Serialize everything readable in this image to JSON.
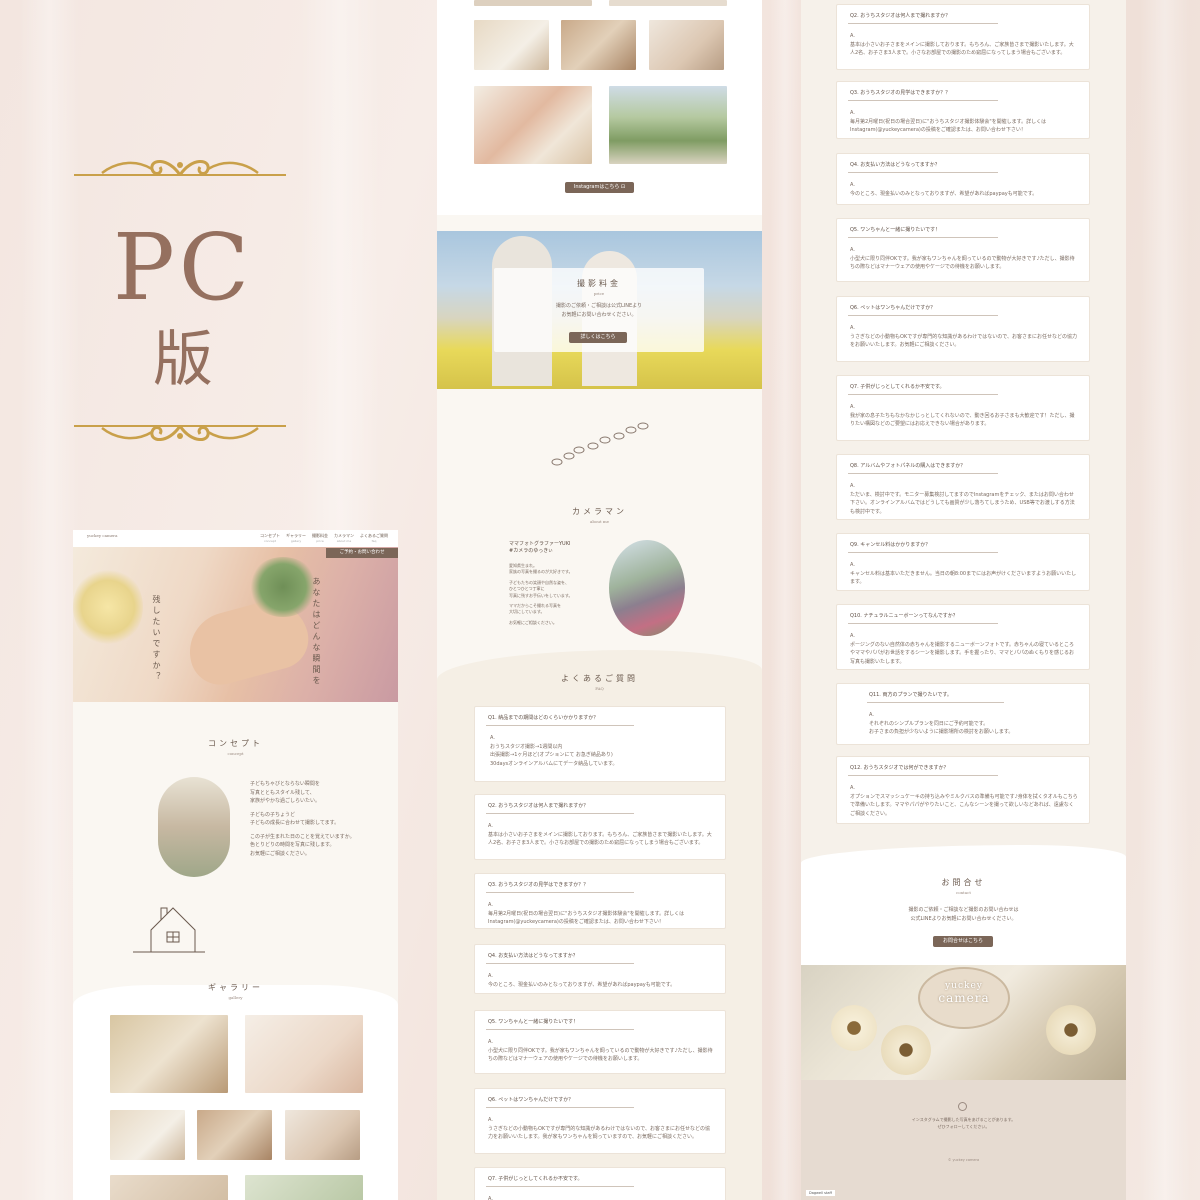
{
  "banner": {
    "title": "PC",
    "subtitle": "版"
  },
  "colors": {
    "accent": "#95705f",
    "gold": "#c9a04a",
    "button": "#7b6658"
  },
  "col1": {
    "logo": "yuckey camera",
    "nav": [
      {
        "ja": "コンセプト",
        "en": "concept"
      },
      {
        "ja": "ギャラリー",
        "en": "gallery"
      },
      {
        "ja": "撮影料金",
        "en": "price"
      },
      {
        "ja": "カメラマン",
        "en": "about me"
      },
      {
        "ja": "よくあるご質問",
        "en": "faq"
      }
    ],
    "contact_tab": "ご予約・お問い合わせ",
    "hero_text_1": "残したいですか？",
    "hero_text_2": "あなたはどんな瞬間を",
    "concept": {
      "title": "コンセプト",
      "en": "concept",
      "body": [
        "子どもちゃびとならない瞬間を",
        "写真とともスタイル残して、",
        "家族がやかな過ごしらいたい。",
        "",
        "子どもの子ちょうど",
        "子どもの成長に合わせて撮影してます。",
        "",
        "この子が生まれた日のことを覚えていますか。",
        "色とりどりの時間を写真に残します。",
        "お気軽にご相談ください。"
      ]
    },
    "gallery": {
      "title": "ギャラリー",
      "en": "gallery"
    }
  },
  "col2": {
    "instagram_button": "Instagramはこちら ⊡",
    "price": {
      "title": "撮影料金",
      "en": "price",
      "body": "撮影のご依頼・ご相談は公式LINEより\nお気軽にお問い合わせください。",
      "button": "詳しくはこちら"
    },
    "photographer": {
      "title": "カメラマン",
      "en": "about me",
      "name_line_1": "ママフォトグラファーYUKI",
      "name_line_2": "#カメラのゆっきぃ",
      "body": [
        "愛知県生まれ。",
        "家族の写真を撮るのが大好きです。",
        "",
        "子どもたちの笑顔や自然な姿を、",
        "ひとつひとつ丁寧に",
        "写真に残すお手伝いをしています。",
        "",
        "ママだからこそ撮れる写真を",
        "大切にしています。",
        "",
        "お気軽にご相談ください。"
      ]
    },
    "faq_title": "よくあるご質問",
    "faq_en": "FAQ",
    "faqs": [
      {
        "q": "Q1. 納品までの期間はどのくらいかかりますか？",
        "a": "A.\nおうちスタジオ撮影→1週間以内\n出張撮影→1ヶ月ほど(オプションにて お急ぎ納品あり)\n30daysオンラインアルバムにてデータ納品しています。"
      },
      {
        "q": "Q2. おうちスタジオは何人まで撮れますか？",
        "a": "A.\n基本は小さいお子さまをメインに撮影しております。もちろん、ご家族皆さまで撮影いたします。大人2名、お子さま3人まで。小さなお部屋での撮影のため窮屈になってしまう場合もございます。"
      },
      {
        "q": "Q3. おうちスタジオの見学はできますか？？",
        "a": "A.\n毎月第2月曜日(祝日の場合翌日)に\"おうちスタジオ撮影体験会\"を開催します。詳しくはInstagram(@yuckeycamera)の投稿をご確認または、お問い合わせ下さい！"
      },
      {
        "q": "Q4. お支払い方法はどうなってますか？",
        "a": "A.\n今のところ、現金払いのみとなっておりますが、希望があればpaypayも可能です。"
      },
      {
        "q": "Q5. ワンちゃんと一緒に撮りたいです！",
        "a": "A.\n小型犬に限り同伴OKです。我が家もワンちゃんを飼っているので動物が大好きです♪ただし、撮影待ちの際などはマナーウェアの使用やケージでの待機をお願いします。"
      },
      {
        "q": "Q6. ペットはワンちゃんだけですか？",
        "a": "A.\nうさぎなどの小動物もOKですが専門的な知識があるわけではないので、お客さまにお任せなどの協力をお願いいたします。我が家もワンちゃんを飼っていますので、お気軽にご相談ください。"
      },
      {
        "q": "Q7. 子供がじっとしてくれるか不安です。",
        "a": "A."
      }
    ]
  },
  "col3": {
    "faqs": [
      {
        "q": "Q2. おうちスタジオは何人まで撮れますか？",
        "a": "A.\n基本は小さいお子さまをメインに撮影しております。もちろん、ご家族皆さまで撮影いたします。大人2名、お子さま3人まで。小さなお部屋での撮影のため窮屈になってしまう場合もございます。"
      },
      {
        "q": "Q3. おうちスタジオの見学はできますか？？",
        "a": "A.\n毎月第2月曜日(祝日の場合翌日)に\"おうちスタジオ撮影体験会\"を開催します。詳しくはInstagram(@yuckeycamera)の投稿をご確認または、お問い合わせ下さい！"
      },
      {
        "q": "Q4. お支払い方法はどうなってますか？",
        "a": "A.\n今のところ、現金払いのみとなっておりますが、希望があればpaypayも可能です。"
      },
      {
        "q": "Q5. ワンちゃんと一緒に撮りたいです！",
        "a": "A.\n小型犬に限り同伴OKです。我が家もワンちゃんを飼っているので動物が大好きです♪ただし、撮影待ちの際などはマナーウェアの使用やケージでの待機をお願いします。"
      },
      {
        "q": "Q6. ペットはワンちゃんだけですか？",
        "a": "A.\nうさぎなどの小動物もOKですが専門的な知識があるわけではないので、お客さまにお任せなどの協力をお願いいたします。お気軽にご相談ください。"
      },
      {
        "q": "Q7. 子供がじっとしてくれるか不安です。",
        "a": "A.\n我が家の息子たちもなかなかじっとしてくれないので、動き回るお子さまも大歓迎です！ただし、撮りたい構図などのご要望にはお応えできない場合があります。"
      },
      {
        "q": "Q8. アルバムやフォトパネルの購入はできますか？",
        "a": "A.\nただいま、検討中です。モニター募集検討してますのでInstagramをチェック、またはお問い合わせ下さい。オンラインアルバムではどうしても画質が少し落ちてしまうため、USB等でお渡しする方法も検討中です。"
      },
      {
        "q": "Q9. キャンセル料はかかりますか？",
        "a": "A.\nキャンセル料は基本いただきません。当日の朝8:00までにはお声がけくださいますようお願いいたします。"
      },
      {
        "q": "Q10. ナチュラルニューボーンってなんですか？",
        "a": "A.\nポージングのない自然体の赤ちゃんを撮影するニューボーンフォトです。赤ちゃんの寝ているところやママやパパがお世話をするシーンを撮影します。手を握ったり、ママとパパのぬくもりを感じるお写真も撮影いたします。"
      },
      {
        "q": "Q11. 両方のプランで撮りたいです。",
        "a": "A.\nそれぞれのシンプルプランを同日にご予約可能です。\nお子さまの負担が少ないように撮影場所の検討をお願いします。"
      },
      {
        "q": "Q12. おうちスタジオでは何ができますか？",
        "a": "A.\nオプションでスマッシュケーキの持ち込みやミルクバスの準備も可能です♪身体を拭くタオルもこちらで準備いたします。ママやパパがやりたいこと、こんなシーンを撮って欲しいなどあれば、遠慮なくご相談ください。"
      }
    ],
    "contact": {
      "title": "お問合せ",
      "en": "contact",
      "body": "撮影のご依頼・ご相談など撮影のお問い合わせは\n公式LINEよりお気軽にお問い合わせください。",
      "button": "お問合せはこちら"
    },
    "badge_1": "yuckey",
    "badge_2": "camera",
    "footer_text": "インスタグラムで撮影した写真をあげることがあります。\nぜひフォローしてください。",
    "footer_copy": "© yuckey camera",
    "footer_badge": "Dagwell staff"
  }
}
